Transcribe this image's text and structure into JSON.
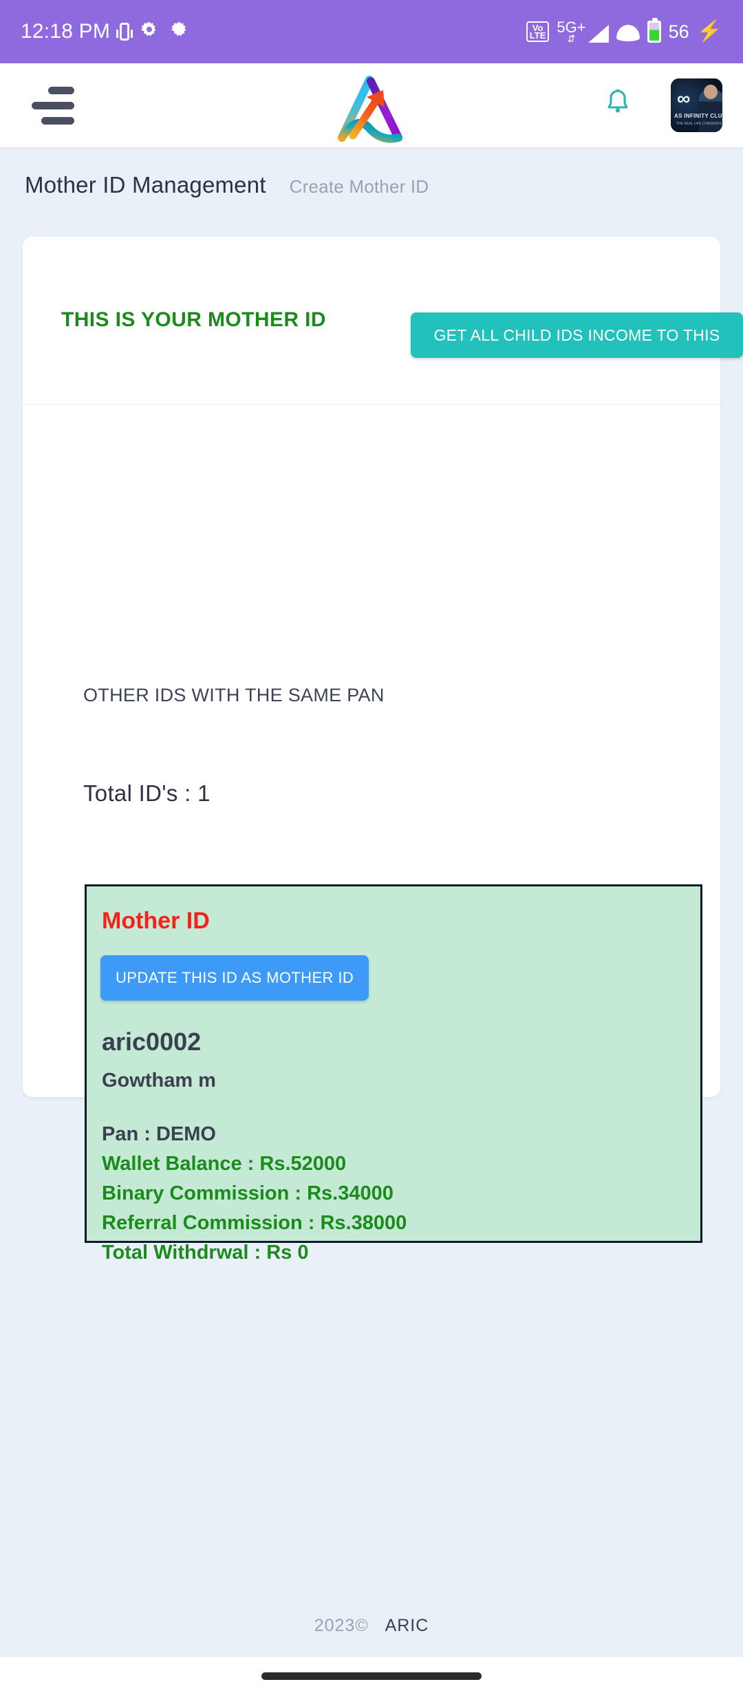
{
  "status_bar": {
    "time": "12:18 PM",
    "network_type": "5G+",
    "volte_label": "VoLTE",
    "battery_level": "56",
    "icons": [
      "vibrate-icon",
      "settings-gear-icon",
      "settings-gear-icon",
      "volte-icon",
      "signal-icon",
      "wifi-icon",
      "battery-icon",
      "charging-bolt-icon"
    ],
    "bg_color": "#8e6ade"
  },
  "app_bar": {
    "menu_label": "",
    "logo_name": "aric-logo",
    "bell_name": "notification-bell",
    "avatar_infinity": "∞",
    "avatar_title": "AS INFINITY CLUB",
    "avatar_sub": "THE REAL LIFE CHANGERS"
  },
  "breadcrumb": {
    "title": "Mother ID Management",
    "sub": "Create Mother ID"
  },
  "main": {
    "mother_id_heading": "THIS IS YOUR MOTHER ID",
    "get_income_button": "GET ALL CHILD IDS INCOME TO THIS ID",
    "other_ids_label": "OTHER IDS WITH THE SAME PAN",
    "total_ids_label": "Total ID's : 1",
    "mother_card": {
      "badge": "Mother ID",
      "update_button": "UPDATE THIS ID AS MOTHER ID",
      "user_id": "aric0002",
      "user_name": "Gowtham m",
      "pan": "Pan : DEMO",
      "wallet_balance": "Wallet Balance : Rs.52000",
      "binary_commission": "Binary Commission : Rs.34000",
      "referral_commission": "Referral Commission : Rs.38000",
      "total_withdrawal": "Total Withdrwal : Rs 0"
    }
  },
  "footer": {
    "year": "2023©",
    "brand": "ARIC"
  },
  "colors": {
    "status_bar": "#8e6ade",
    "teal_button": "#23c1bb",
    "blue_button": "#3d9bf7",
    "green_text": "#1b8b1b",
    "red_text": "#f3231a",
    "green_card_bg": "#c4e9d4",
    "page_bg": "#eaf0f7"
  }
}
